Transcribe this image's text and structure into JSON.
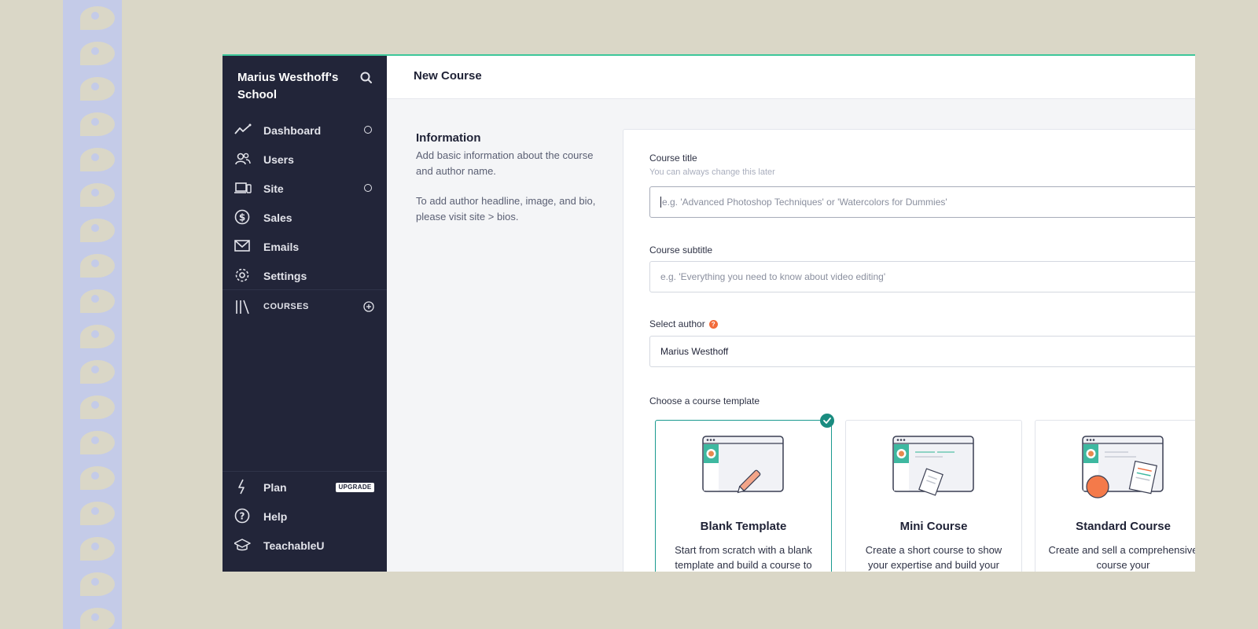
{
  "sidebar": {
    "school_name": "Marius Westhoff's School",
    "items": [
      {
        "label": "Dashboard",
        "icon": "chart-line-icon",
        "dot": true
      },
      {
        "label": "Users",
        "icon": "users-icon",
        "dot": false
      },
      {
        "label": "Site",
        "icon": "devices-icon",
        "dot": true
      },
      {
        "label": "Sales",
        "icon": "dollar-circle-icon",
        "dot": false
      },
      {
        "label": "Emails",
        "icon": "envelope-icon",
        "dot": false
      },
      {
        "label": "Settings",
        "icon": "gear-icon",
        "dot": false
      }
    ],
    "courses_label": "COURSES",
    "bottom": [
      {
        "label": "Plan",
        "icon": "lightning-icon"
      },
      {
        "label": "Help",
        "icon": "help-circle-icon"
      },
      {
        "label": "TeachableU",
        "icon": "graduation-cap-icon"
      }
    ],
    "upgrade_label": "UPGRADE"
  },
  "header": {
    "title": "New Course"
  },
  "info": {
    "heading": "Information",
    "text1": "Add basic information about the course and author name.",
    "text2": "To add author headline, image, and bio, please visit site > bios."
  },
  "form": {
    "title_label": "Course title",
    "title_hint": "You can always change this later",
    "title_placeholder": "e.g. 'Advanced Photoshop Techniques' or 'Watercolors for Dummies'",
    "subtitle_label": "Course subtitle",
    "subtitle_placeholder": "e.g. 'Everything you need to know about video editing'",
    "author_label": "Select author",
    "author_value": "Marius Westhoff",
    "template_label": "Choose a course template"
  },
  "templates": [
    {
      "name": "Blank Template",
      "desc": "Start from scratch with a blank template and build a course to",
      "selected": true
    },
    {
      "name": "Mini Course",
      "desc": "Create a short course to show your expertise and build your",
      "selected": false
    },
    {
      "name": "Standard Course",
      "desc": "Create and sell a comprehensive course your",
      "selected": false
    }
  ],
  "colors": {
    "sidebar": "#222539",
    "accent": "#1a9a90",
    "top_border": "#3ec79a",
    "help_icon": "#f26b3a"
  }
}
